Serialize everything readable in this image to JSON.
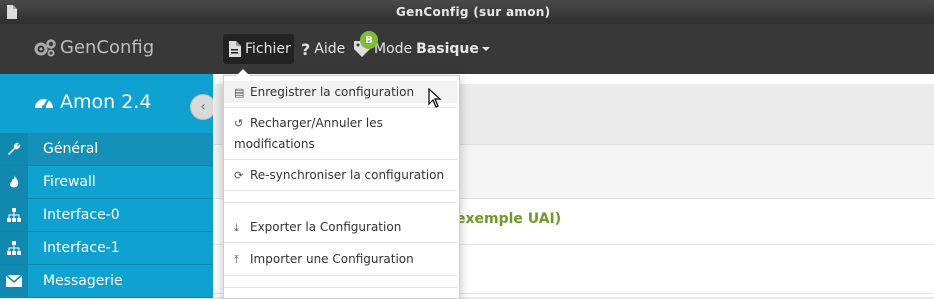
{
  "window": {
    "title": "GenConfig (sur amon)"
  },
  "navbar": {
    "brand": "GenConfig",
    "fichier": "Fichier",
    "aide": "Aide",
    "mode_label": "Mode",
    "mode_value": "Basique",
    "mode_badge": "B"
  },
  "sidebar": {
    "server": "Amon 2.4",
    "items": [
      {
        "label": "Général",
        "icon": "wrench-icon"
      },
      {
        "label": "Firewall",
        "icon": "fire-icon"
      },
      {
        "label": "Interface-0",
        "icon": "sitemap-icon"
      },
      {
        "label": "Interface-1",
        "icon": "sitemap-icon"
      },
      {
        "label": "Messagerie",
        "icon": "envelope-icon"
      }
    ]
  },
  "content": {
    "row_title": "t (exemple UAI)"
  },
  "dropdown": {
    "items": [
      {
        "label": "Enregistrer la configuration",
        "icon": "hdd-icon"
      },
      {
        "label": "Recharger/Annuler les modifications",
        "icon": "undo-icon"
      },
      {
        "label": "Re-synchroniser la configuration",
        "icon": "refresh-icon"
      },
      {
        "label": "Exporter la Configuration",
        "icon": "download-icon"
      },
      {
        "label": "Importer une Configuration",
        "icon": "upload-icon"
      }
    ]
  },
  "colors": {
    "sidebar": "#0fa1cf",
    "navbar": "#383838",
    "accent_green": "#6f9a2a",
    "badge": "#7cbe3a"
  }
}
